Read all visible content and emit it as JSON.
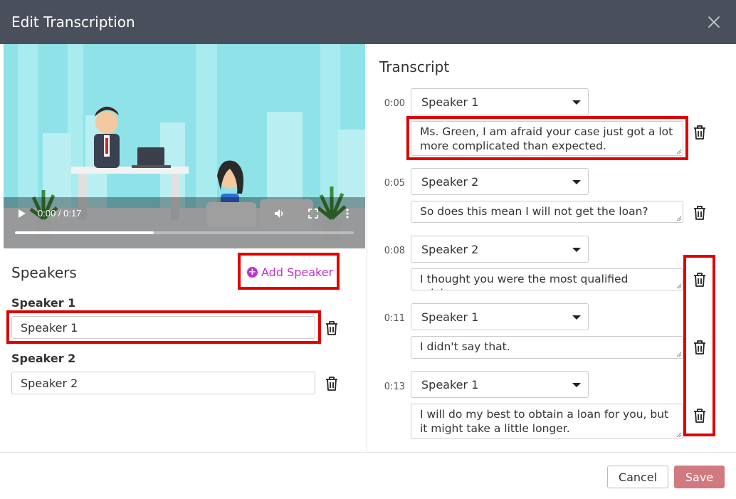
{
  "dialog": {
    "title": "Edit Transcription"
  },
  "video": {
    "time": "0:00 / 0:17",
    "progress": 0.41
  },
  "speakers": {
    "title": "Speakers",
    "add_label": "Add Speaker",
    "items": [
      {
        "label": "Speaker 1",
        "value": "Speaker 1"
      },
      {
        "label": "Speaker 2",
        "value": "Speaker 2"
      }
    ]
  },
  "transcript": {
    "title": "Transcript",
    "entries": [
      {
        "time": "0:00",
        "speaker": "Speaker 1",
        "text": "Ms. Green, I am afraid your case just got a lot more complicated than expected."
      },
      {
        "time": "0:05",
        "speaker": "Speaker 2",
        "text": "So does this mean I will not get the loan?"
      },
      {
        "time": "0:08",
        "speaker": "Speaker 2",
        "text": "I thought you were the most qualified adviser."
      },
      {
        "time": "0:11",
        "speaker": "Speaker 1",
        "text": "I didn't say that."
      },
      {
        "time": "0:13",
        "speaker": "Speaker 1",
        "text": "I will do my best to obtain a loan for you, but it might take a little longer."
      }
    ]
  },
  "footer": {
    "cancel_label": "Cancel",
    "save_label": "Save"
  },
  "colors": {
    "header_bg": "#4a4f5c",
    "accent": "#c22fcf",
    "save_bg": "#d07a7f",
    "highlight": "#e00000"
  }
}
